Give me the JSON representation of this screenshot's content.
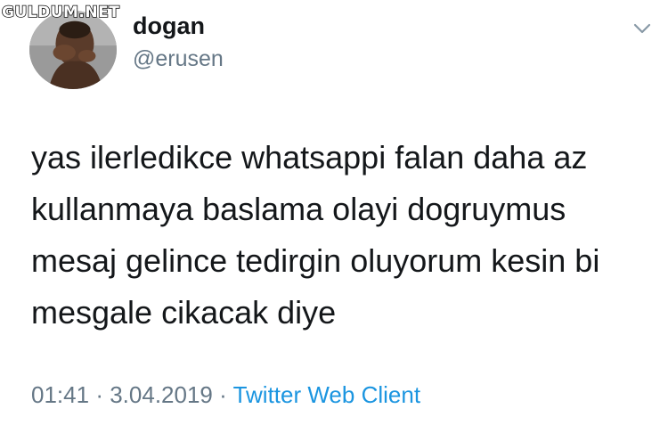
{
  "watermark": {
    "text": "GULDUM.NET"
  },
  "user": {
    "display_name": "dogan",
    "handle": "@erusen"
  },
  "tweet": {
    "lines": [
      "yas ilerledikce whatsappi falan daha az",
      "kullanmaya baslama olayi dogruymus",
      "mesaj gelince tedirgin oluyorum kesin bi",
      "mesgale cikacak diye"
    ],
    "time": "01:41",
    "separator": "·",
    "date": "3.04.2019",
    "source": "Twitter Web Client"
  },
  "icons": {
    "menu": "chevron-down-icon",
    "avatar": "profile-photo"
  },
  "colors": {
    "text": "#14171a",
    "muted": "#657786",
    "link": "#1b95e0"
  }
}
